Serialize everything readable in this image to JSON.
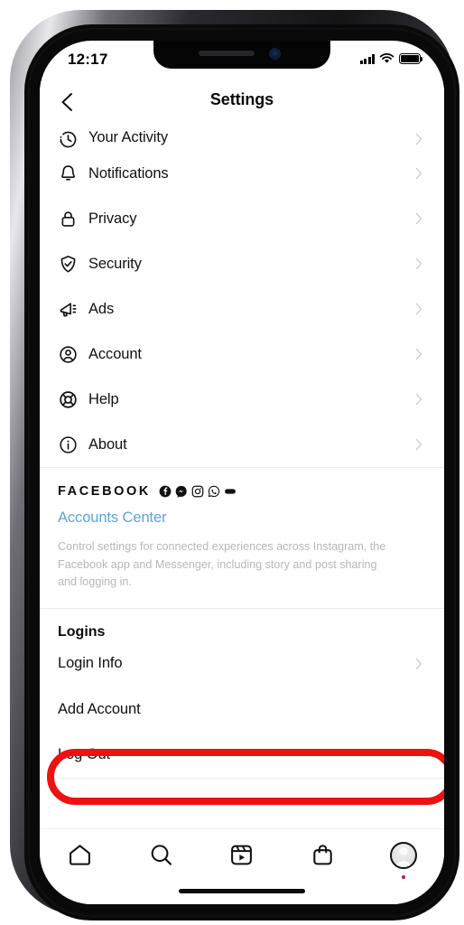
{
  "status_bar": {
    "time": "12:17",
    "signal_icon": "cellular-signal-icon",
    "wifi_icon": "wifi-icon",
    "battery_icon": "battery-full-icon"
  },
  "header": {
    "back_icon": "back-chevron-icon",
    "title": "Settings"
  },
  "settings_list": [
    {
      "label": "Your Activity",
      "icon": "clock-history-icon",
      "clipped": true
    },
    {
      "label": "Notifications",
      "icon": "bell-icon"
    },
    {
      "label": "Privacy",
      "icon": "lock-icon"
    },
    {
      "label": "Security",
      "icon": "shield-check-icon"
    },
    {
      "label": "Ads",
      "icon": "megaphone-icon"
    },
    {
      "label": "Account",
      "icon": "person-circle-icon"
    },
    {
      "label": "Help",
      "icon": "life-ring-icon"
    },
    {
      "label": "About",
      "icon": "info-circle-icon"
    }
  ],
  "facebook_section": {
    "heading": "FACEBOOK",
    "app_icons": [
      "facebook-icon",
      "messenger-icon",
      "instagram-icon",
      "whatsapp-icon",
      "portal-icon"
    ],
    "accounts_center_link": "Accounts Center",
    "description": "Control settings for connected experiences across Instagram, the Facebook app and Messenger, including story and post sharing and logging in."
  },
  "logins_section": {
    "title": "Logins",
    "login_info_label": "Login Info",
    "add_account_link": "Add Account",
    "log_out_link": "Log Out"
  },
  "tab_bar": [
    {
      "icon": "home-icon"
    },
    {
      "icon": "search-icon"
    },
    {
      "icon": "reels-icon"
    },
    {
      "icon": "shop-bag-icon"
    },
    {
      "icon": "profile-avatar-icon"
    }
  ],
  "annotation": {
    "shape": "red-rounded-rectangle-highlight",
    "target": "Log Out",
    "color": "#ee1111"
  },
  "colors": {
    "link_blue": "#5ba3d9",
    "text_primary": "#111111",
    "text_muted": "#b7b7b7",
    "divider": "#e9e9e9",
    "annotation_red": "#ee1111"
  }
}
